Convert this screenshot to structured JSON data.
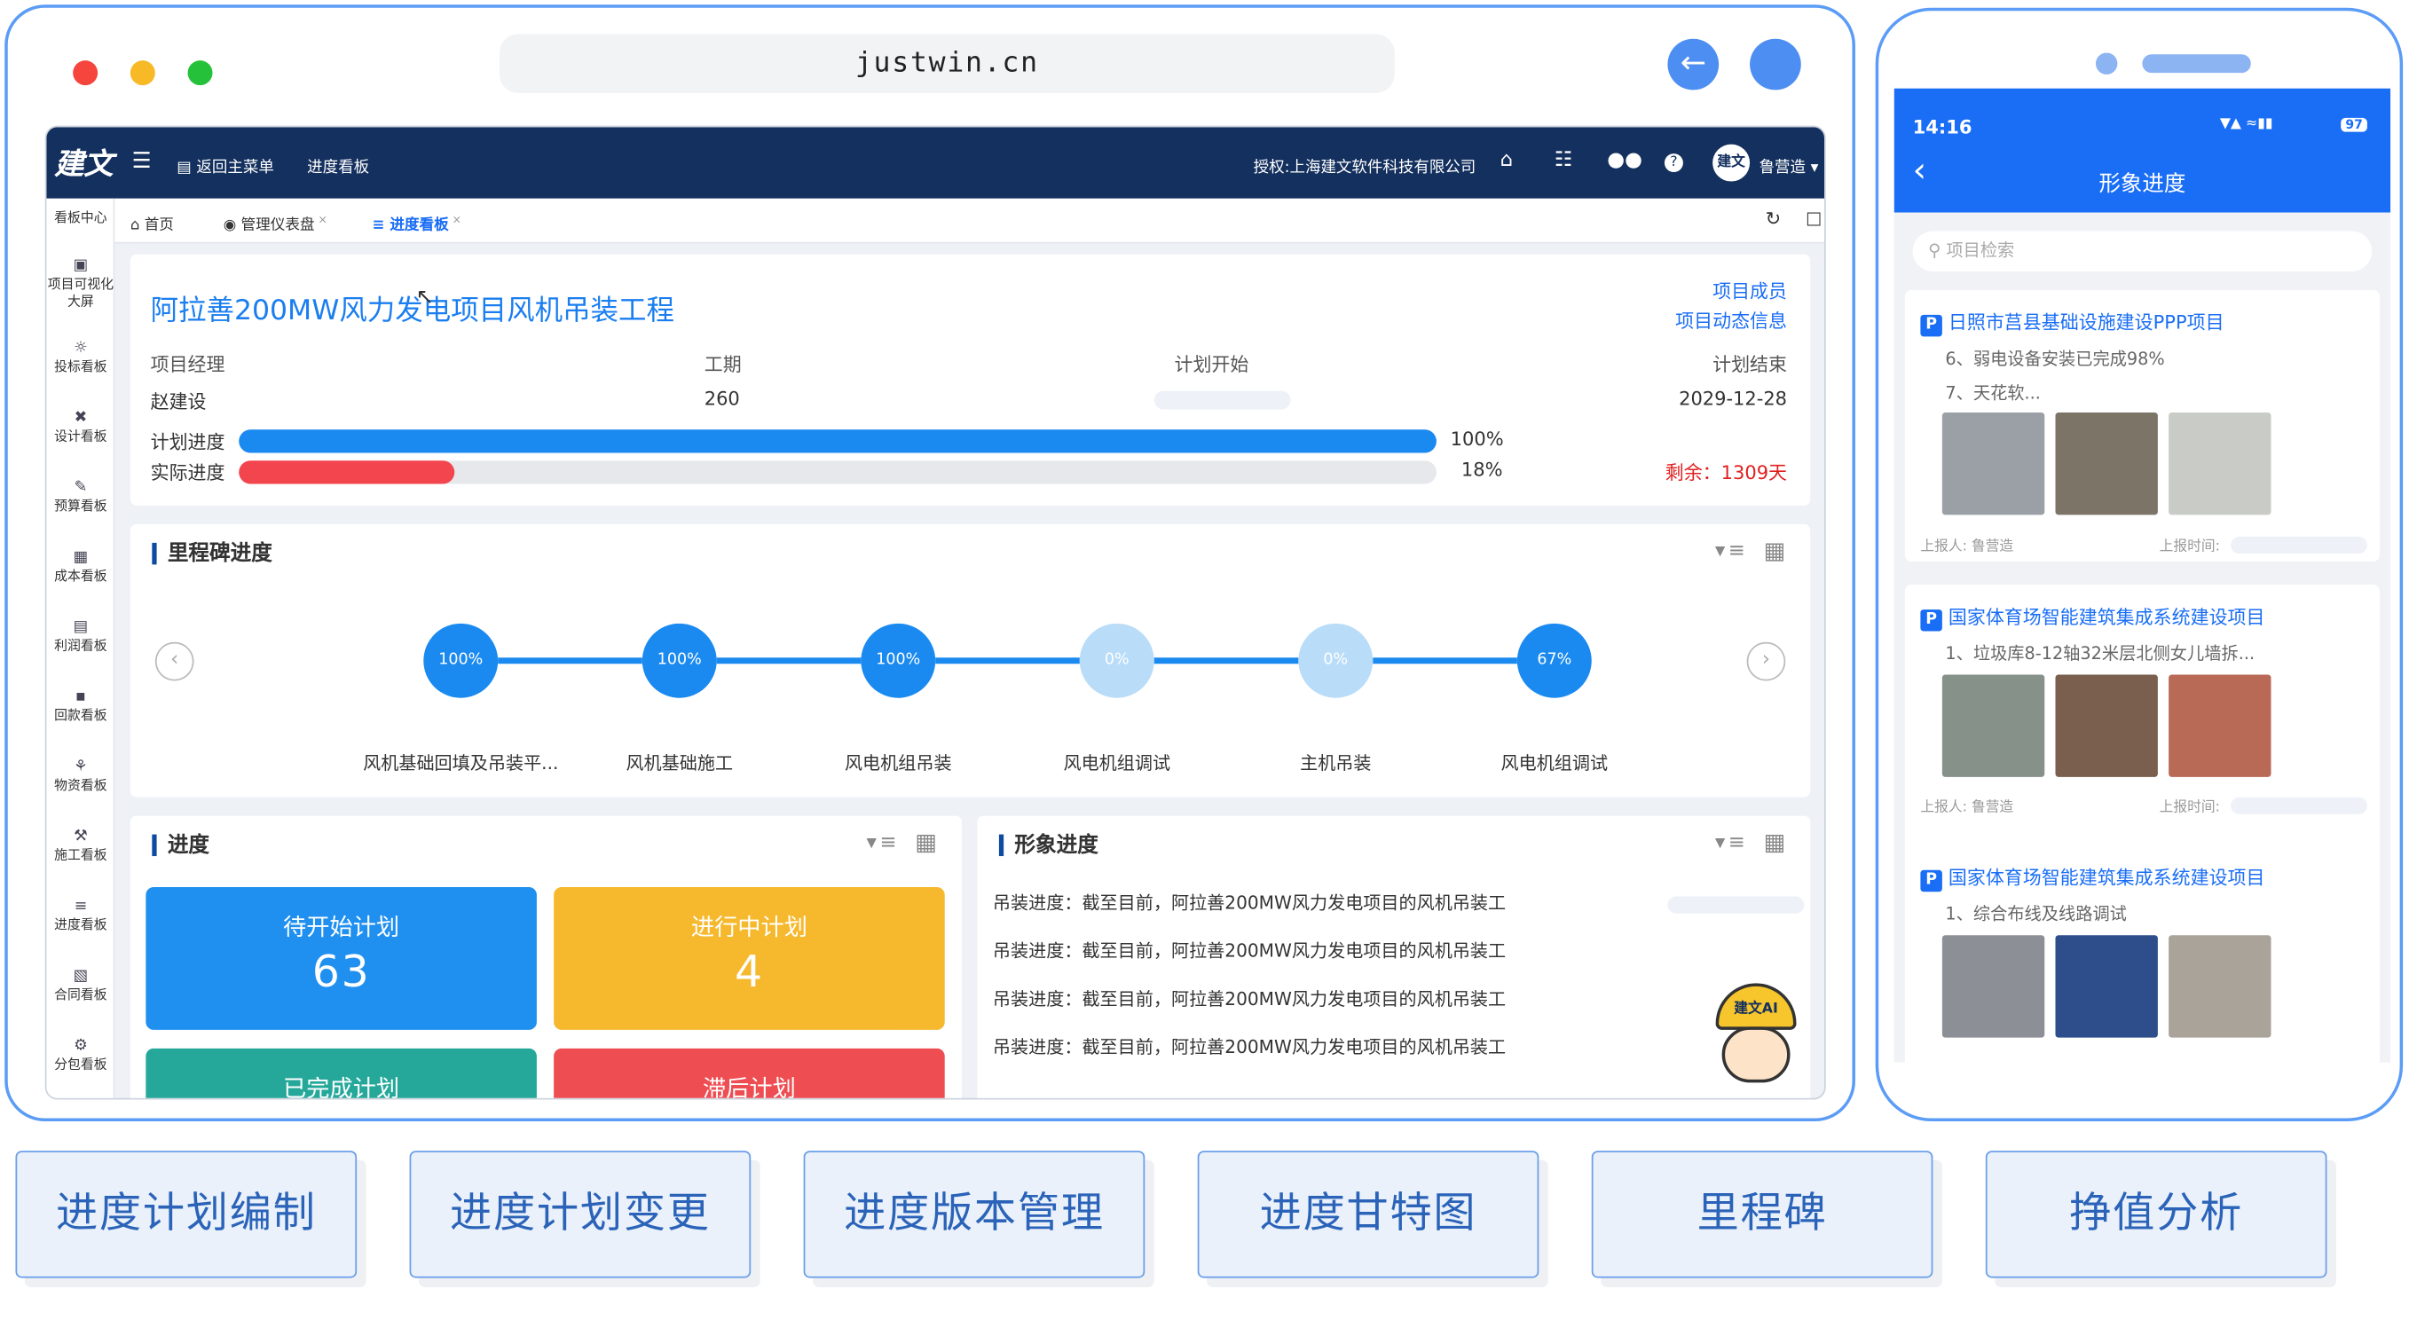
{
  "browser": {
    "url": "justwin.cn",
    "back_icon": "arrow-left-icon"
  },
  "app": {
    "logo": "建文",
    "nav": {
      "back_main": "返回主菜单",
      "board": "进度看板",
      "auth": "授权:上海建文软件科技有限公司",
      "user": "鲁营造",
      "avatar": "建文"
    },
    "sidebar": [
      "看板中心",
      "项目可视化大屏",
      "投标看板",
      "设计看板",
      "预算看板",
      "成本看板",
      "利润看板",
      "回款看板",
      "物资看板",
      "施工看板",
      "进度看板",
      "合同看板",
      "分包看板"
    ],
    "tabs": {
      "home": "首页",
      "dashboard": "管理仪表盘",
      "progress": "进度看板"
    },
    "project": {
      "title": "阿拉善200MW风力发电项目风机吊装工程",
      "link_members": "项目成员",
      "link_dynamics": "项目动态信息",
      "manager_label": "项目经理",
      "manager": "赵建设",
      "duration_label": "工期",
      "duration": "260",
      "start_label": "计划开始",
      "end_label": "计划结束",
      "end": "2029-12-28",
      "plan_label": "计划进度",
      "plan_pct": "100%",
      "plan_value": 100,
      "actual_label": "实际进度",
      "actual_pct": "18%",
      "actual_value": 18,
      "remaining": "剩余：1309天"
    },
    "milestones": {
      "title": "里程碑进度",
      "items": [
        {
          "pct": "100%",
          "name": "风机基础回填及吊装平...",
          "value": 100
        },
        {
          "pct": "100%",
          "name": "风机基础施工",
          "value": 100
        },
        {
          "pct": "100%",
          "name": "风电机组吊装",
          "value": 100
        },
        {
          "pct": "0%",
          "name": "风电机组调试",
          "value": 0
        },
        {
          "pct": "0%",
          "name": "主机吊装",
          "value": 0
        },
        {
          "pct": "67%",
          "name": "风电机组调试",
          "value": 67
        }
      ]
    },
    "progress": {
      "title": "进度",
      "tiles": [
        {
          "label": "待开始计划",
          "value": "63",
          "color": "#1f8ff0"
        },
        {
          "label": "进行中计划",
          "value": "4",
          "color": "#f6b82c"
        },
        {
          "label": "已完成计划",
          "value": "",
          "color": "#25a89a"
        },
        {
          "label": "滞后计划",
          "value": "",
          "color": "#ee4d52"
        }
      ]
    },
    "image_progress": {
      "title": "形象进度",
      "ai_label": "建文AI",
      "lines": [
        "吊装进度：截至目前，阿拉善200MW风力发电项目的风机吊装工",
        "吊装进度：截至目前，阿拉善200MW风力发电项目的风机吊装工",
        "吊装进度：截至目前，阿拉善200MW风力发电项目的风机吊装工",
        "吊装进度：截至目前，阿拉善200MW风力发电项目的风机吊装工"
      ]
    }
  },
  "phone": {
    "time": "14:16",
    "battery": "97",
    "title": "形象进度",
    "search_placeholder": "项目检索",
    "items": [
      {
        "title": "日照市莒县基础设施建设PPP项目",
        "lines": [
          "6、弱电设备安装已完成98%",
          "7、天花软..."
        ],
        "reporter_label": "上报人:",
        "reporter": "鲁营造",
        "time_label": "上报时间:"
      },
      {
        "title": "国家体育场智能建筑集成系统建设项目",
        "lines": [
          "1、垃圾库8-12轴32米层北侧女儿墙拆..."
        ],
        "reporter_label": "上报人:",
        "reporter": "鲁营造",
        "time_label": "上报时间:"
      },
      {
        "title": "国家体育场智能建筑集成系统建设项目",
        "lines": [
          "1、综合布线及线路调试"
        ],
        "reporter_label": "",
        "reporter": "",
        "time_label": ""
      }
    ]
  },
  "features": [
    "进度计划编制",
    "进度计划变更",
    "进度版本管理",
    "进度甘特图",
    "里程碑",
    "挣值分析"
  ],
  "colors": {
    "accent": "#1a6ef5",
    "navbar": "#14305e",
    "milestone_done": "#1a8af0",
    "milestone_todo": "#b9dcf8",
    "actual_bar": "#f3454d"
  }
}
